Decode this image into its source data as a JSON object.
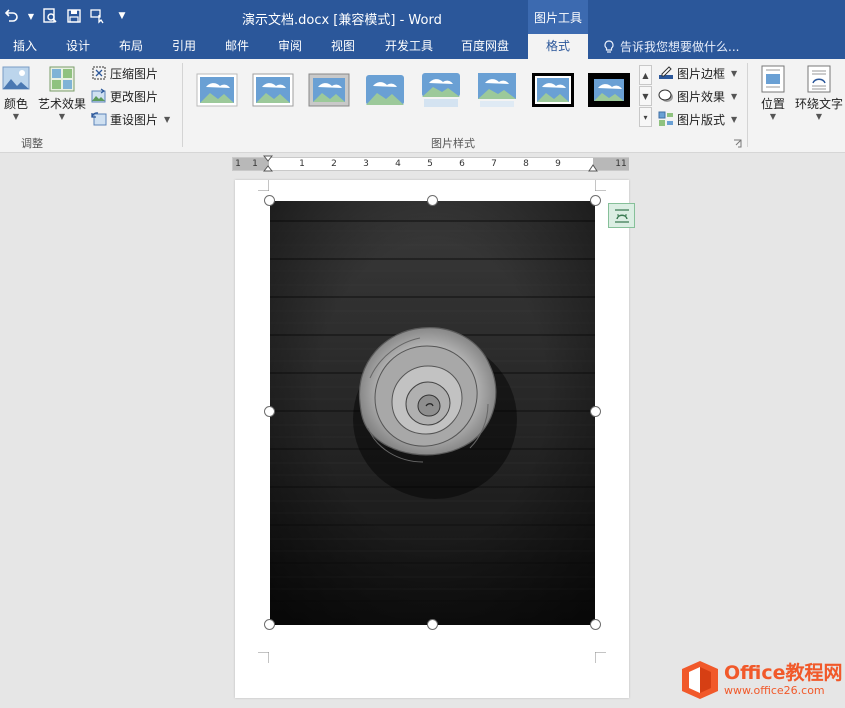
{
  "window": {
    "title": "演示文档.docx [兼容模式] - Word",
    "context_tab_group": "图片工具"
  },
  "qat": {
    "icons": [
      "undo-icon",
      "print-preview-icon",
      "save-as-icon",
      "touch-mode-icon",
      "customize-qat-icon"
    ]
  },
  "tabs": [
    {
      "label": "插入"
    },
    {
      "label": "设计"
    },
    {
      "label": "布局"
    },
    {
      "label": "引用"
    },
    {
      "label": "邮件"
    },
    {
      "label": "审阅"
    },
    {
      "label": "视图"
    },
    {
      "label": "开发工具"
    },
    {
      "label": "百度网盘"
    },
    {
      "label": "格式",
      "active": true
    }
  ],
  "tell_me": "告诉我您想要做什么...",
  "ribbon": {
    "adjust": {
      "color_label": "颜色",
      "artistic_label": "艺术效果",
      "compress_label": "压缩图片",
      "change_label": "更改图片",
      "reset_label": "重设图片",
      "group_label": "调整"
    },
    "styles": {
      "group_label": "图片样式",
      "border_label": "图片边框",
      "effects_label": "图片效果",
      "layout_label": "图片版式"
    },
    "arrange": {
      "position_label": "位置",
      "wrap_label": "环绕文字"
    }
  },
  "ruler": {
    "numbers": [
      "1",
      "1",
      "1",
      "2",
      "3",
      "4",
      "5",
      "6",
      "7",
      "8",
      "9",
      "11"
    ]
  },
  "document": {
    "picture": "black-and-white rose on dark wooden table",
    "selected": true
  },
  "watermark": {
    "title": "Office教程网",
    "url": "www.office26.com"
  },
  "colors": {
    "ribbon_blue": "#2b579a",
    "context_blue": "#3c6ab0",
    "ribbon_bg": "#f3f3f3",
    "canvas_bg": "#e6e6e6",
    "watermark_orange": "#f1592a"
  }
}
